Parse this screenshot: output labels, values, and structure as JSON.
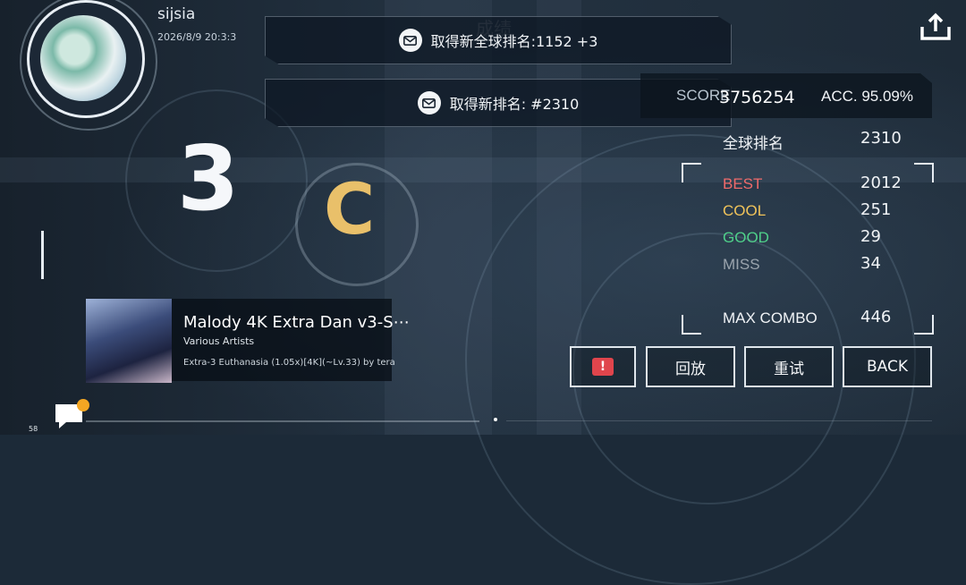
{
  "profile": {
    "username": "sijsia",
    "datetime": "2026/8/9 20:3:3"
  },
  "watermark": "成绩",
  "notices": [
    {
      "text": "取得新全球排名:1152 +3"
    },
    {
      "text": "取得新排名: #2310"
    }
  ],
  "result": {
    "big_number": "3",
    "grade": "C"
  },
  "score": {
    "label": "SCORE",
    "value": "3756254",
    "acc_text": "ACC. 95.09%"
  },
  "stats": {
    "rank_label": "全球排名",
    "rank_value": "2310",
    "best_label": "BEST",
    "best_value": "2012",
    "cool_label": "COOL",
    "cool_value": "251",
    "good_label": "GOOD",
    "good_value": "29",
    "miss_label": "MISS",
    "miss_value": "34",
    "combo_label": "MAX COMBO",
    "combo_value": "446"
  },
  "colors": {
    "best": "#ef6b6b",
    "cool": "#f0c35a",
    "good": "#4fd08a",
    "miss": "#9aa4ad",
    "grade": "#e9c06a",
    "report": "#e0454c",
    "badge": "#f4a623"
  },
  "song": {
    "title": "Malody 4K Extra Dan v3-S⋯",
    "artist": "Various Artists",
    "difficulty": "Extra-3 Euthanasia (1.05x)[4K](~Lv.33) by tera"
  },
  "buttons": {
    "report_icon": "!",
    "replay": "回放",
    "retry": "重试",
    "back": "BACK"
  },
  "status": {
    "fps": "58"
  },
  "icons": {
    "share": "share-icon",
    "mail": "mail-icon",
    "report": "report-icon",
    "chat": "chat-icon"
  }
}
